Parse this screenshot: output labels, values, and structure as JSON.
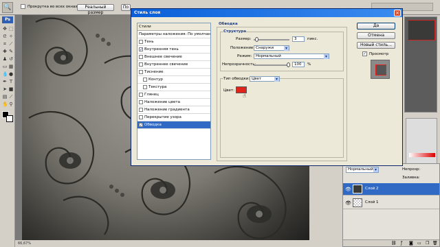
{
  "options_bar": {
    "checkbox_scroll_all": "Прокрутка во всех окнах",
    "btn_actual": "Реальный размер",
    "btn_fit": "По"
  },
  "dialog": {
    "title": "Стиль слоя",
    "close": "×",
    "styles_header": "Стили",
    "style_items": [
      {
        "label": "Параметры наложения: По умолчанию",
        "checkbox": false,
        "checked": false,
        "selected": false
      },
      {
        "label": "Тень",
        "checkbox": true,
        "checked": false,
        "selected": false
      },
      {
        "label": "Внутренняя тень",
        "checkbox": true,
        "checked": true,
        "selected": false
      },
      {
        "label": "Внешнее свечение",
        "checkbox": true,
        "checked": false,
        "selected": false
      },
      {
        "label": "Внутреннее свечение",
        "checkbox": true,
        "checked": false,
        "selected": false
      },
      {
        "label": "Тиснение",
        "checkbox": true,
        "checked": false,
        "selected": false
      },
      {
        "label": "Контур",
        "checkbox": true,
        "checked": false,
        "selected": false,
        "indent": true
      },
      {
        "label": "Текстура",
        "checkbox": true,
        "checked": false,
        "selected": false,
        "indent": true
      },
      {
        "label": "Глянец",
        "checkbox": true,
        "checked": false,
        "selected": false
      },
      {
        "label": "Наложение цвета",
        "checkbox": true,
        "checked": false,
        "selected": false
      },
      {
        "label": "Наложение градиента",
        "checkbox": true,
        "checked": false,
        "selected": false
      },
      {
        "label": "Перекрытие узора",
        "checkbox": true,
        "checked": false,
        "selected": false
      },
      {
        "label": "Обводка",
        "checkbox": true,
        "checked": true,
        "selected": true
      }
    ],
    "stroke": {
      "section_title": "Обводка",
      "structure_title": "Структура",
      "size_label": "Размер:",
      "size_value": "3",
      "size_unit": "пикс.",
      "position_label": "Положение:",
      "position_value": "Снаружи",
      "blend_label": "Режим:",
      "blend_value": "Нормальный",
      "opacity_label": "Непрозрачность:",
      "opacity_value": "100",
      "opacity_unit": "%",
      "fill_type_label": "Тип обводки:",
      "fill_type_value": "Цвет",
      "color_label": "Цвет:",
      "color_swatch": "#e0241b"
    },
    "buttons": {
      "ok": "Да",
      "cancel": "Отмена",
      "new_style": "Новый стиль...",
      "preview": "Просмотр"
    }
  },
  "layers_panel": {
    "blend_mode": "Нормальный",
    "opacity_label": "Непрозр:",
    "fill_label": "Заливка:",
    "layers": [
      {
        "name": "Слой 2",
        "selected": true
      },
      {
        "name": "Слой 1",
        "selected": false
      }
    ]
  },
  "status_bar": {
    "text": "66,67%"
  }
}
